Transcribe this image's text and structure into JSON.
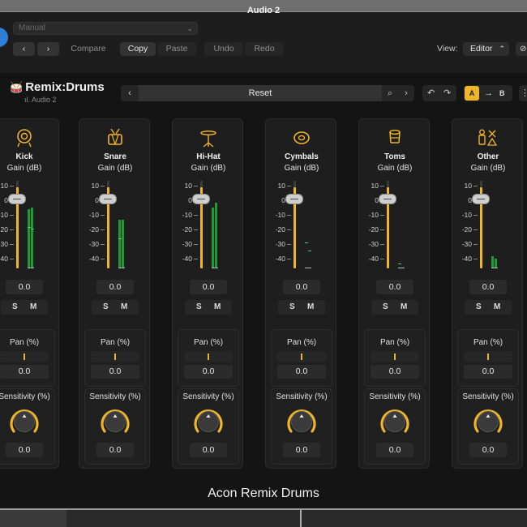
{
  "window": {
    "title": "Audio 2"
  },
  "header": {
    "preset_value": "Manual",
    "compare_label": "Compare",
    "copy_label": "Copy",
    "paste_label": "Paste",
    "undo_label": "Undo",
    "redo_label": "Redo",
    "view_label": "View:",
    "view_value": "Editor"
  },
  "plugin": {
    "name": "Remix:Drums",
    "subtitle": "Audio 2",
    "preset_nav": "Reset",
    "ab": {
      "a": "A",
      "b": "B"
    },
    "footer": "Acon Remix Drums"
  },
  "scale": [
    "10",
    "0",
    "-10",
    "-20",
    "-30",
    "-40"
  ],
  "labels": {
    "gain": "Gain (dB)",
    "pan": "Pan (%)",
    "sensitivity": "Sensitivity (%)",
    "solo": "S",
    "mute": "M"
  },
  "channels": [
    {
      "name": "Kick",
      "icon": "kick-drum-icon",
      "gain": "0.0",
      "pan": "0.0",
      "sensitivity": "0.0",
      "meter_l": 0.7,
      "meter_r": 0.72,
      "peak_l": 0.48,
      "peak_r": 0.46
    },
    {
      "name": "Snare",
      "icon": "snare-drum-icon",
      "gain": "0.0",
      "pan": "0.0",
      "sensitivity": "0.0",
      "meter_l": 0.58,
      "meter_r": 0.58,
      "peak_l": 0.35,
      "peak_r": 0.0
    },
    {
      "name": "Hi-Hat",
      "icon": "hihat-icon",
      "gain": "0.0",
      "pan": "0.0",
      "sensitivity": "0.0",
      "meter_l": 0.72,
      "meter_r": 0.78,
      "peak_l": 0.0,
      "peak_r": 0.0
    },
    {
      "name": "Cymbals",
      "icon": "cymbals-icon",
      "gain": "0.0",
      "pan": "0.0",
      "sensitivity": "0.0",
      "meter_l": 0.0,
      "meter_r": 0.0,
      "peak_l": 0.3,
      "peak_r": 0.2
    },
    {
      "name": "Toms",
      "icon": "toms-icon",
      "gain": "0.0",
      "pan": "0.0",
      "sensitivity": "0.0",
      "meter_l": 0.0,
      "meter_r": 0.0,
      "peak_l": 0.05,
      "peak_r": 0.0
    },
    {
      "name": "Other",
      "icon": "other-percussion-icon",
      "gain": "0.0",
      "pan": "0.0",
      "sensitivity": "0.0",
      "meter_l": 0.14,
      "meter_r": 0.12,
      "peak_l": 0.0,
      "peak_r": 0.0
    }
  ],
  "colors": {
    "accent": "#f0b429",
    "meter": "#1e9a3a",
    "panel": "#1e1e1e"
  }
}
